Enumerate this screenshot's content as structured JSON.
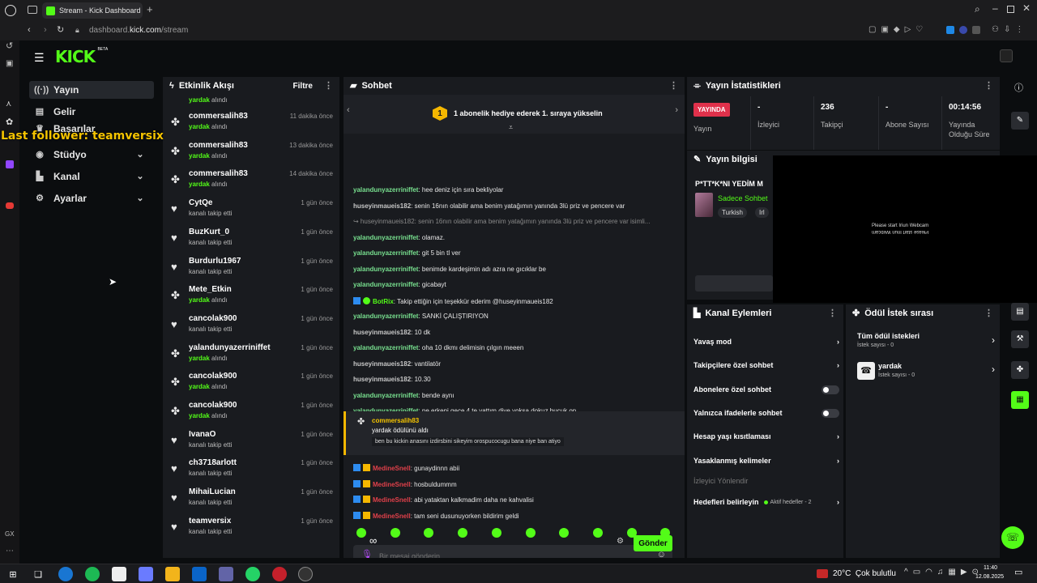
{
  "browser": {
    "tab_title": "Stream - Kick Dashboard",
    "url_domain": "dashboard.",
    "url_host": "kick.com",
    "url_path": "/stream"
  },
  "brand": {
    "logo": "KICK",
    "beta": "BETA",
    "accent": "#53fc18"
  },
  "overlay": {
    "last_follower": "Last follower: teamversix",
    "color": "#f5c400"
  },
  "sidebar": {
    "items": [
      {
        "label": "Yayın",
        "icon": "broadcast-icon",
        "active": true
      },
      {
        "label": "Gelir",
        "icon": "wallet-icon"
      },
      {
        "label": "Başarılar",
        "icon": "trophy-icon"
      },
      {
        "label": "Stüdyo",
        "icon": "studio-icon",
        "expand": true
      },
      {
        "label": "Kanal",
        "icon": "channel-icon",
        "expand": true
      },
      {
        "label": "Ayarlar",
        "icon": "gear-icon",
        "expand": true
      }
    ]
  },
  "activity": {
    "title": "Etkinlik Akışı",
    "filter": "Filtre",
    "top_partial": {
      "reward": "yardak",
      "suffix": "alındı"
    },
    "items": [
      {
        "name": "commersalih83",
        "reward": "yardak",
        "text": "alındı",
        "time": "11 dakika önce",
        "type": "reward"
      },
      {
        "name": "commersalih83",
        "reward": "yardak",
        "text": "alındı",
        "time": "13 dakika önce",
        "type": "reward"
      },
      {
        "name": "commersalih83",
        "reward": "yardak",
        "text": "alındı",
        "time": "14 dakika önce",
        "type": "reward"
      },
      {
        "name": "CytQe",
        "reward": "",
        "text": "kanalı takip etti",
        "time": "1 gün önce",
        "type": "follow"
      },
      {
        "name": "BuzKurt_0",
        "reward": "",
        "text": "kanalı takip etti",
        "time": "1 gün önce",
        "type": "follow"
      },
      {
        "name": "Burdurlu1967",
        "reward": "",
        "text": "kanalı takip etti",
        "time": "1 gün önce",
        "type": "follow"
      },
      {
        "name": "Mete_Etkin",
        "reward": "yardak",
        "text": "alındı",
        "time": "1 gün önce",
        "type": "reward"
      },
      {
        "name": "cancolak900",
        "reward": "",
        "text": "kanalı takip etti",
        "time": "1 gün önce",
        "type": "follow"
      },
      {
        "name": "yalandunyazerriniffet",
        "reward": "yardak",
        "text": "alındı",
        "time": "1 gün önce",
        "type": "reward"
      },
      {
        "name": "cancolak900",
        "reward": "yardak",
        "text": "alındı",
        "time": "1 gün önce",
        "type": "reward"
      },
      {
        "name": "cancolak900",
        "reward": "yardak",
        "text": "alındı",
        "time": "1 gün önce",
        "type": "reward"
      },
      {
        "name": "IvanaO",
        "reward": "",
        "text": "kanalı takip etti",
        "time": "1 gün önce",
        "type": "follow"
      },
      {
        "name": "ch3718arlott",
        "reward": "",
        "text": "kanalı takip etti",
        "time": "1 gün önce",
        "type": "follow"
      },
      {
        "name": "MihaiLucian",
        "reward": "",
        "text": "kanalı takip etti",
        "time": "1 gün önce",
        "type": "follow"
      },
      {
        "name": "teamversix",
        "reward": "",
        "text": "kanalı takip etti",
        "time": "1 gün önce",
        "type": "follow"
      }
    ]
  },
  "chat": {
    "title": "Sohbet",
    "pinned": {
      "badge": "1",
      "text": "1 abonelik hediye ederek 1. sıraya yükselin"
    },
    "messages": [
      {
        "user": "yalandunyazerriniffet",
        "color": "green",
        "text": "hee deniz için sıra bekliyolar"
      },
      {
        "user": "huseyinmaueis182",
        "color": "grey",
        "text": "senin 16nın olabilir ama benim yatağımın yanında 3lü priz ve pencere var"
      },
      {
        "user": "↪ huseyinmaueis182:",
        "color": "faded",
        "text": "senin 16nın olabilir ama benim yatağımın yanında 3lü priz ve pencere var isimli..."
      },
      {
        "user": "yalandunyazerriniffet",
        "color": "green",
        "text": "olamaz."
      },
      {
        "user": "yalandunyazerriniffet",
        "color": "green",
        "text": "git 5 bin tl ver"
      },
      {
        "user": "yalandunyazerriniffet",
        "color": "green",
        "text": "benimde kardeşimin adı azra ne gıcıklar be"
      },
      {
        "user": "yalandunyazerriniffet",
        "color": "green",
        "text": "gicabayt"
      },
      {
        "user": "BotRix",
        "color": "bot",
        "text": "Takip ettiğin için teşekkür ederim @huseyinmaueis182"
      },
      {
        "user": "yalandunyazerriniffet",
        "color": "green",
        "text": "SANKİ ÇALIŞTIRIYON"
      },
      {
        "user": "huseyinmaueis182",
        "color": "grey",
        "text": "10 dk"
      },
      {
        "user": "yalandunyazerriniffet",
        "color": "green",
        "text": "oha 10 dkmı delimisin çılgın meeen"
      },
      {
        "user": "huseyinmaueis182",
        "color": "grey",
        "text": "vantilatör"
      },
      {
        "user": "huseyinmaueis182",
        "color": "grey",
        "text": "10.30"
      },
      {
        "user": "yalandunyazerriniffet",
        "color": "green",
        "text": "bende aynı"
      },
      {
        "user": "yalandunyazerriniffet",
        "color": "green",
        "text": "ne erkeni gece 4 te yattım diye yoksa dokuz bucuk on"
      }
    ],
    "redemption": {
      "user": "commersalih83",
      "line": "yardak ödülünü aldı",
      "quote": "ben bu kickin anasını izdirsbini sikeyim orospucocugu bana niye ban atiyo"
    },
    "messages2": [
      {
        "user": "MedineSnell",
        "text": "gunaydinnn abii"
      },
      {
        "user": "MedineSnell",
        "text": "hosbuldummm"
      },
      {
        "user": "MedineSnell",
        "text": "abi yataktan kalkmadim daha ne kahvalisi"
      },
      {
        "user": "MedineSnell",
        "text": "tam seni dusunuyorken bildirim geldi"
      }
    ],
    "input_placeholder": "Bir mesaj gönderin",
    "points": "∞",
    "send": "Gönder"
  },
  "stats": {
    "title": "Yayın İstatistikleri",
    "live_badge": "YAYINDA",
    "live_label": "Yayın",
    "items": [
      {
        "value": "-",
        "label": "İzleyici"
      },
      {
        "value": "236",
        "label": "Takipçi"
      },
      {
        "value": "-",
        "label": "Abone Sayısı"
      },
      {
        "value": "00:14:56",
        "label": "Yayında Olduğu Süre"
      }
    ]
  },
  "stream_info": {
    "title": "Yayın bilgisi",
    "stream_title": "P*TT*K*NI YEDİM M",
    "category": "Sadece Sohbet",
    "tags": [
      "Turkish",
      "Irl"
    ]
  },
  "webcam": {
    "text": "Please start Iriun Webcam",
    "mirror": "Please start Iriun Webcam"
  },
  "channel_actions": {
    "title": "Kanal Eylemleri",
    "items": [
      {
        "label": "Yavaş mod",
        "kind": "arrow"
      },
      {
        "label": "Takipçilere özel sohbet",
        "kind": "arrow"
      },
      {
        "label": "Abonelere özel sohbet",
        "kind": "toggle"
      },
      {
        "label": "Yalnızca ifadelerle sohbet",
        "kind": "toggle"
      },
      {
        "label": "Hesap yaşı kısıtlaması",
        "kind": "arrow"
      },
      {
        "label": "Yasaklanmış kelimeler",
        "kind": "arrow"
      }
    ],
    "disabled": "İzleyici Yönlendir",
    "goals": {
      "label": "Hedefleri belirleyin",
      "status": "Aktif hedefler - 2"
    }
  },
  "rewards": {
    "title": "Ödül İstek sırası",
    "items": [
      {
        "name": "Tüm ödül istekleri",
        "sub": "İstek sayısı - 0"
      },
      {
        "name": "yardak",
        "sub": "İstek sayısı - 0"
      }
    ]
  },
  "taskbar": {
    "weather": "20°C  Çok bulutlu",
    "time": "11:40",
    "date": "12.08.2025"
  }
}
